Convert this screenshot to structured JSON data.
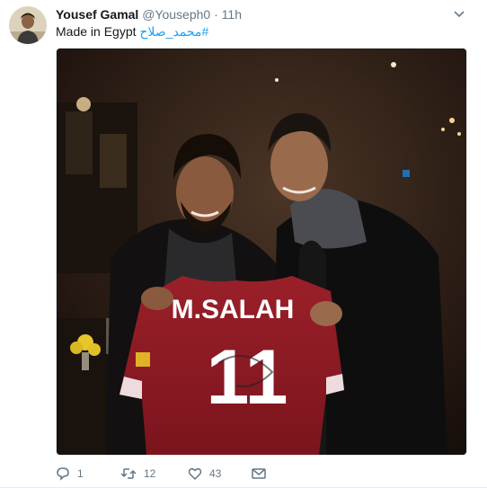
{
  "tweet": {
    "author_name": "Yousef Gamal",
    "handle": "@Youseph0",
    "separator": "·",
    "time": "11h",
    "text": "Made in Egypt ",
    "hashtag": "محمد_صلاح#",
    "image": {
      "jersey_name": "M.SALAH",
      "jersey_number": "11"
    },
    "actions": {
      "replies": "1",
      "retweets": "12",
      "likes": "43"
    }
  },
  "colors": {
    "link": "#1da1f2",
    "muted": "#657786",
    "text": "#14171a",
    "jersey": "#8e1b25"
  },
  "icons": [
    "avatar-photo",
    "chevron-down-icon",
    "reply-icon",
    "retweet-icon",
    "like-icon",
    "message-icon"
  ]
}
